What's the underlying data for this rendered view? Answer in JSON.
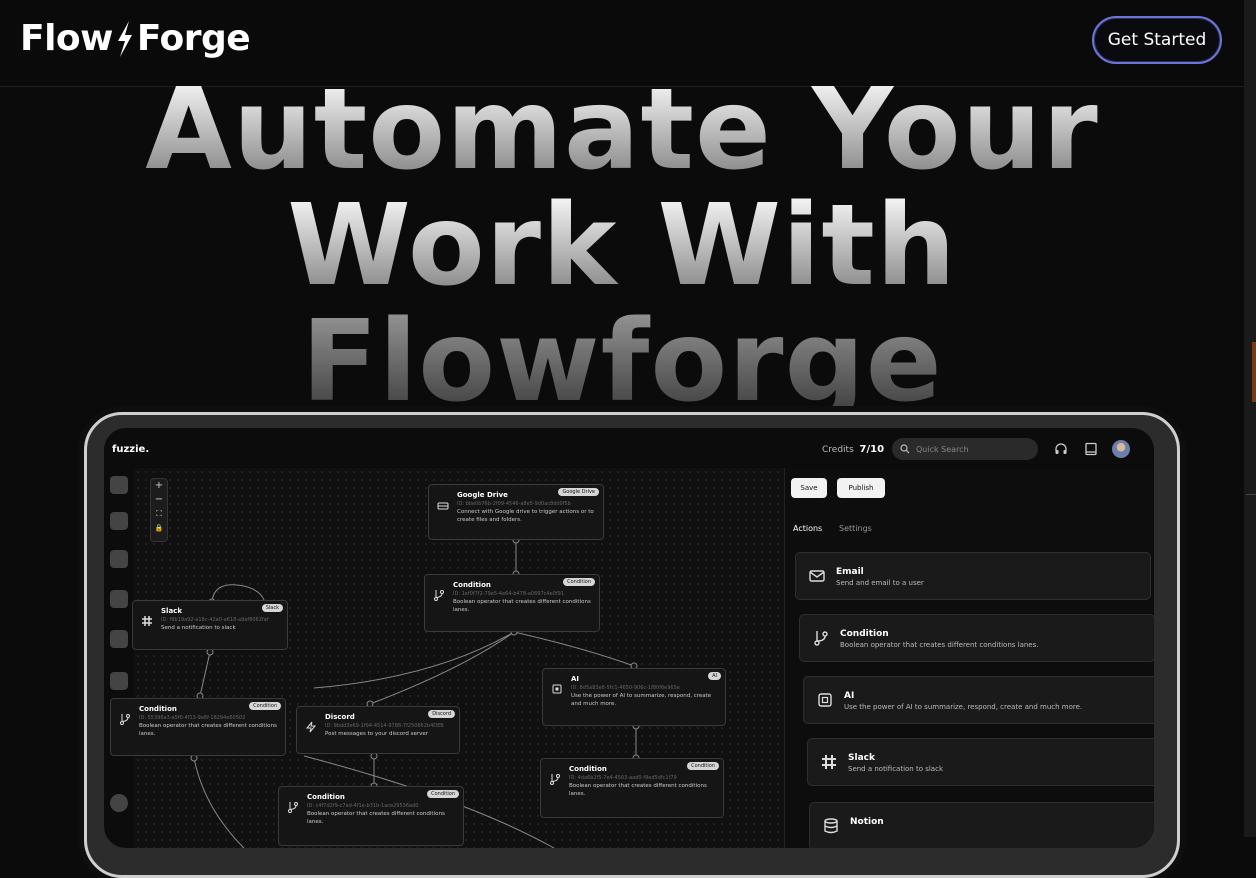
{
  "nav": {
    "logo_left": "Flow",
    "logo_right": "Forge",
    "cta_label": "Get Started"
  },
  "hero": {
    "line1": "Automate Your",
    "line2": "Work With",
    "line3": "Flowforge"
  },
  "app": {
    "logo": "fuzzie.",
    "credits_label": "Credits",
    "credits_value": "7/10",
    "search_placeholder": "Quick Search",
    "icons": [
      "headphones-icon",
      "book-icon",
      "avatar"
    ]
  },
  "canvas": {
    "zoom_controls": [
      "+",
      "−",
      "⛶",
      "🔒"
    ],
    "nodes": [
      {
        "title": "Google Drive",
        "badge": "Google Drive",
        "id": "ID: bbe0b76b-2f09-4546-a8e5-9d0ac8dd0f5b",
        "desc": "Connect with Google drive to trigger actions or to create files and folders."
      },
      {
        "title": "Condition",
        "badge": "Condition",
        "id": "ID: 1ef0f7f2-79e5-4e64-b478-a0697c4e0f91",
        "desc": "Boolean operator that creates different conditions lanes."
      },
      {
        "title": "Slack",
        "badge": "Slack",
        "id": "ID: f9b19a92-a18c-42a0-a618-a9ef8062faf",
        "desc": "Send a notification to slack"
      },
      {
        "title": "AI",
        "badge": "AI",
        "id": "ID: 8d5a83e6-5fc1-4650-906c-1f80f6e965e",
        "desc": "Use the power of AI to summarize, respond, create and much more."
      },
      {
        "title": "Condition",
        "badge": "Condition",
        "id": "ID: 55396a3-a5f0-4f13-9e6f-18294e60502",
        "desc": "Boolean operator that creates different conditions lanes."
      },
      {
        "title": "Discord",
        "badge": "Discord",
        "id": "ID: 9bdd3e69-1f94-4514-9788-7f250862b4DEB",
        "desc": "Post messages to your discord server"
      },
      {
        "title": "Condition",
        "badge": "Condition",
        "id": "ID: 4da6b2f5-7e4-4503-aad0-f9ed5dfc1f79",
        "desc": "Boolean operator that creates different conditions lanes."
      },
      {
        "title": "Condition",
        "badge": "Condition",
        "id": "ID: c4f7d2f9-c7ad-4f1e-b31b-1ace29536ad0",
        "desc": "Boolean operator that creates different conditions lanes."
      }
    ]
  },
  "panel": {
    "save_label": "Save",
    "publish_label": "Publish",
    "tab_actions": "Actions",
    "tab_settings": "Settings",
    "actions": [
      {
        "title": "Email",
        "desc": "Send and email to a user",
        "icon": "mail-icon"
      },
      {
        "title": "Condition",
        "desc": "Boolean operator that creates different conditions lanes.",
        "icon": "git-branch-icon"
      },
      {
        "title": "AI",
        "desc": "Use the power of AI to summarize, respond, create and much more.",
        "icon": "cpu-icon"
      },
      {
        "title": "Slack",
        "desc": "Send a notification to slack",
        "icon": "slack-icon"
      },
      {
        "title": "Notion",
        "desc": "",
        "icon": "database-icon"
      }
    ]
  }
}
